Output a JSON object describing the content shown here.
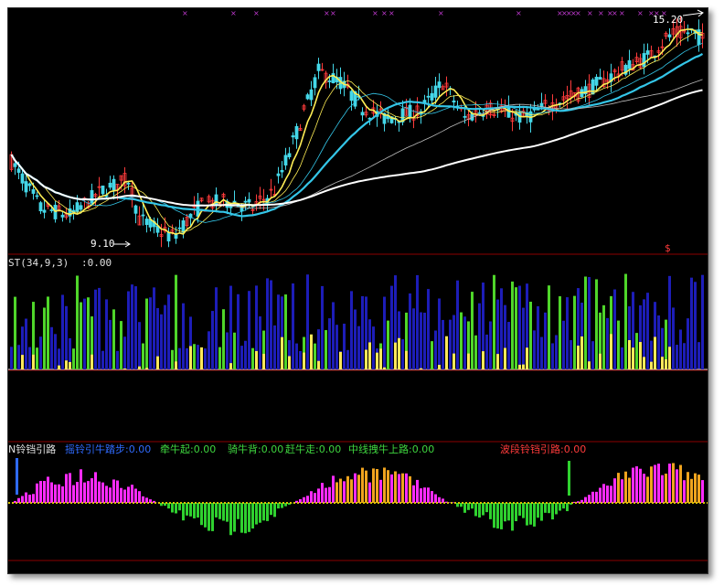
{
  "colors": {
    "background": "#000000",
    "divider": "#8b0000",
    "up_candle": "#ff3b3b",
    "down_candle": "#44d7e8",
    "ma_yellow": "#ffee55",
    "ma_cyan": "#34c6e8",
    "ma_white": "#ffffff",
    "vol_blue": "#1d1db8",
    "vol_green": "#4fd62a",
    "vol_yellow": "#ffe95a",
    "osc_magenta": "#ff2bff",
    "osc_green": "#2fd12f",
    "osc_orange": "#f0a41e",
    "label_blue": "#2f6bff",
    "label_green": "#3fd63f",
    "label_red": "#ff3b3b",
    "marker_purple": "#c23ad2"
  },
  "price_panel": {
    "high_label": "15.20",
    "low_label": "9.10",
    "dollar_marker": "$"
  },
  "volume_panel": {
    "indicator_name": "ST(34,9,3)",
    "indicator_value": ":0.00"
  },
  "osc_panel": {
    "title": "N铃铛引路",
    "labels": [
      {
        "text": "摇铃引牛踏步:0.00",
        "color": "#2f6bff"
      },
      {
        "text": "牵牛起:0.00",
        "color": "#3fd63f"
      },
      {
        "text": "骑牛背:0.00",
        "color": "#3fd63f"
      },
      {
        "text": "赶牛走:0.00",
        "color": "#3fd63f"
      },
      {
        "text": "中线拽牛上路:0.00",
        "color": "#3fd63f"
      },
      {
        "text": "波段铃铛引路:0.00",
        "color": "#ff3b3b"
      }
    ]
  },
  "chart_data": {
    "type": "candlestick",
    "price_range": [
      9.1,
      15.2
    ],
    "annotations": {
      "high": 15.2,
      "low": 9.1
    }
  }
}
